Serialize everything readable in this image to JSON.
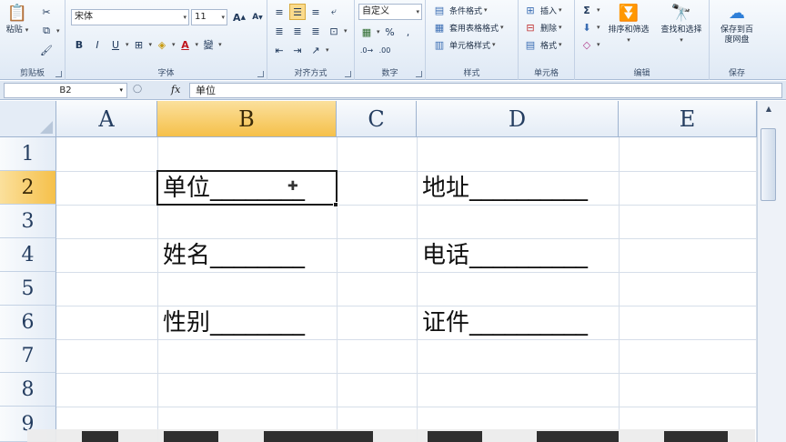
{
  "ribbon": {
    "clipboard": {
      "paste": "粘贴",
      "label": "剪贴板"
    },
    "font": {
      "name": "宋体",
      "size": "11",
      "bold": "B",
      "italic": "I",
      "underline": "U",
      "grow": "A",
      "shrink": "A",
      "color_a": "A",
      "phonetic": "變",
      "label": "字体"
    },
    "alignment": {
      "label": "对齐方式"
    },
    "number": {
      "format": "自定义",
      "percent": "%",
      "comma": ",",
      "label": "数字"
    },
    "styles": {
      "conditional": "条件格式",
      "table": "套用表格格式",
      "cell": "单元格样式",
      "label": "样式"
    },
    "cells": {
      "insert": "插入",
      "delete": "删除",
      "format": "格式",
      "label": "单元格"
    },
    "editing": {
      "sort": "排序和筛选",
      "find": "查找和选择",
      "label": "编辑"
    },
    "save": {
      "line1": "保存到百",
      "line2": "度网盘",
      "label": "保存"
    }
  },
  "formula_bar": {
    "name_box": "B2",
    "fx": "fx",
    "content": "单位"
  },
  "grid": {
    "columns": [
      "A",
      "B",
      "C",
      "D",
      "E"
    ],
    "rows": [
      "1",
      "2",
      "3",
      "4",
      "5",
      "6",
      "7",
      "8",
      "9"
    ],
    "cells": {
      "B2": "单位________",
      "D2": "地址__________",
      "B4": "姓名________",
      "D4": "电话__________",
      "B6": "性别________",
      "D6": "证件__________"
    }
  },
  "colors": {
    "selected_header": "#f5c04a",
    "grid_line": "#d6dee9",
    "ribbon_bg": "#dfe9f5"
  }
}
